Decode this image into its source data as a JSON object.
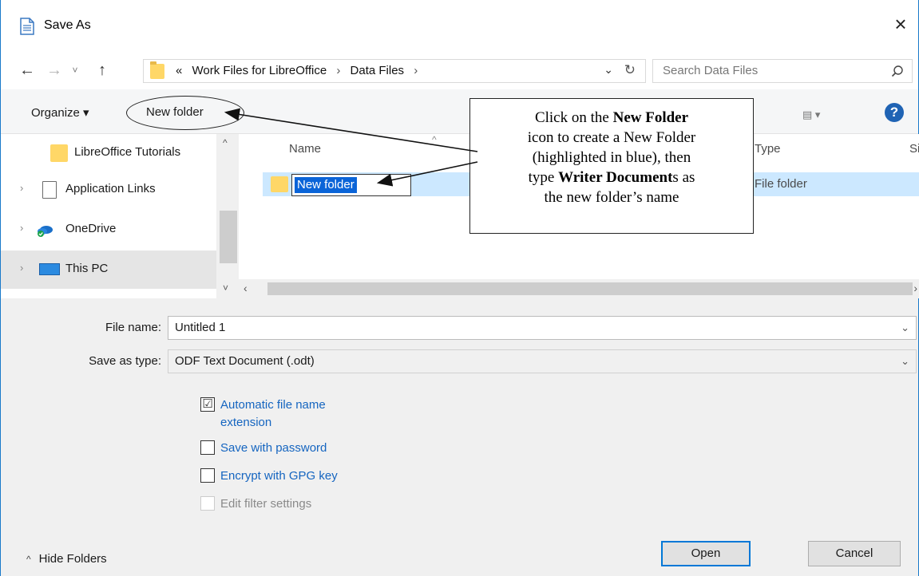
{
  "window": {
    "title": "Save As",
    "close_glyph": "×",
    "accent": "#1979ca"
  },
  "nav": {
    "back_glyph": "←",
    "forward_glyph": "→",
    "recent_glyph": "˅",
    "up_glyph": "↑",
    "address": {
      "overflow": "«",
      "crumbs": [
        "Work Files for LibreOffice",
        "Data Files"
      ],
      "separator": "›",
      "dropdown_glyph": "⌄",
      "refresh_glyph": "↻"
    },
    "search_placeholder": "Search Data Files"
  },
  "toolbar": {
    "organize_label": "Organize ▾",
    "new_folder_label": "New folder",
    "view_glyph": "▤ ▾",
    "help_glyph": "?"
  },
  "sidebar": {
    "items": [
      {
        "label": "LibreOffice Tutorials",
        "icon": "folder-icon",
        "expander": ""
      },
      {
        "label": "Application Links",
        "icon": "document-icon",
        "expander": "›"
      },
      {
        "label": "OneDrive",
        "icon": "onedrive-cloud-icon",
        "expander": "›"
      },
      {
        "label": "This PC",
        "icon": "computer-icon",
        "expander": "›"
      }
    ],
    "scroll_up_glyph": "^",
    "scroll_down_glyph": "˅"
  },
  "files": {
    "columns": {
      "name": "Name",
      "type": "Type",
      "size": "Si"
    },
    "sort_glyph": "^",
    "rows": [
      {
        "name": "New folder",
        "type": "File folder"
      }
    ],
    "scroll_left_glyph": "‹",
    "scroll_right_glyph": "›"
  },
  "form": {
    "file_name_label": "File name:",
    "file_name_value": "Untitled 1",
    "save_as_type_label": "Save as type:",
    "save_as_type_value": "ODF Text Document (.odt)",
    "combo_glyph": "⌄"
  },
  "options": [
    {
      "label": "Automatic file name",
      "label2": "extension",
      "checked": "☑",
      "enabled": true
    },
    {
      "label": "Save with password",
      "checked": "",
      "enabled": true
    },
    {
      "label": "Encrypt with GPG key",
      "checked": "",
      "enabled": true
    },
    {
      "label": "Edit filter settings",
      "checked": "",
      "enabled": false
    }
  ],
  "footer": {
    "hide_folders_glyph": "^",
    "hide_folders_label": "Hide Folders",
    "open_label": "Open",
    "cancel_label": "Cancel"
  },
  "callout": {
    "line1_pre": "Click on the ",
    "line1_bold": "New Folder",
    "line2": "icon to create a New Folder",
    "line3": "(highlighted in blue), then",
    "line4_pre": "type ",
    "line4_bold": "Writer Document",
    "line4_post": "s as",
    "line5": "the new folder’s name"
  },
  "colors": {
    "selection_blue": "#0a64d8",
    "row_highlight": "#cce8ff",
    "link_blue": "#1565c0",
    "help_blue": "#1f63b4",
    "folder_yellow": "#ffd767"
  }
}
